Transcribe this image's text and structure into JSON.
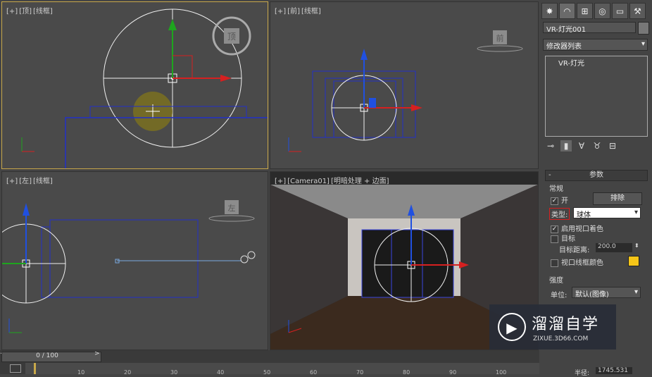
{
  "viewports": {
    "top": {
      "label": [
        "[+]",
        "[顶]",
        "[线框]"
      ],
      "cube_face": "顶"
    },
    "front": {
      "label": [
        "[+]",
        "[前]",
        "[线框]"
      ],
      "cube_face": "前"
    },
    "left": {
      "label": [
        "[+]",
        "[左]",
        "[线框]"
      ],
      "cube_face": "左"
    },
    "camera": {
      "label": [
        "[+]",
        "[Camera01]",
        "[明暗处理 + 边面]"
      ]
    }
  },
  "panel": {
    "tabs": [
      "create-icon",
      "modify-icon",
      "hierarchy-icon",
      "motion-icon",
      "display-icon",
      "utilities-icon"
    ],
    "object_name": "VR-灯光001",
    "modifier_list": "修改器列表",
    "stack_item": "VR-灯光",
    "rollout_title": "参数",
    "general_label": "常规",
    "on_label": "开",
    "exclude_label": "排除",
    "type_label": "类型:",
    "type_value": "球体",
    "viewport_shading_label": "启用视口着色",
    "target_label": "目标",
    "target_distance_label": "目标距离:",
    "target_distance_value": "200.0",
    "wire_color_label": "视口线框颜色",
    "wire_color": "#f5c518",
    "intensity_label": "强度",
    "unit_label": "单位:",
    "unit_value": "默认(图像)",
    "radius_label": "半径:",
    "radius_value": "1745.531"
  },
  "watermark": {
    "logo_glyph": "▶",
    "title": "溜溜自学",
    "url": "ZIXUE.3D66.COM"
  },
  "timeline": {
    "frame_text": "0 / 100",
    "ticks": [
      "10",
      "20",
      "30",
      "40",
      "50",
      "60",
      "70",
      "80",
      "90",
      "100"
    ]
  }
}
